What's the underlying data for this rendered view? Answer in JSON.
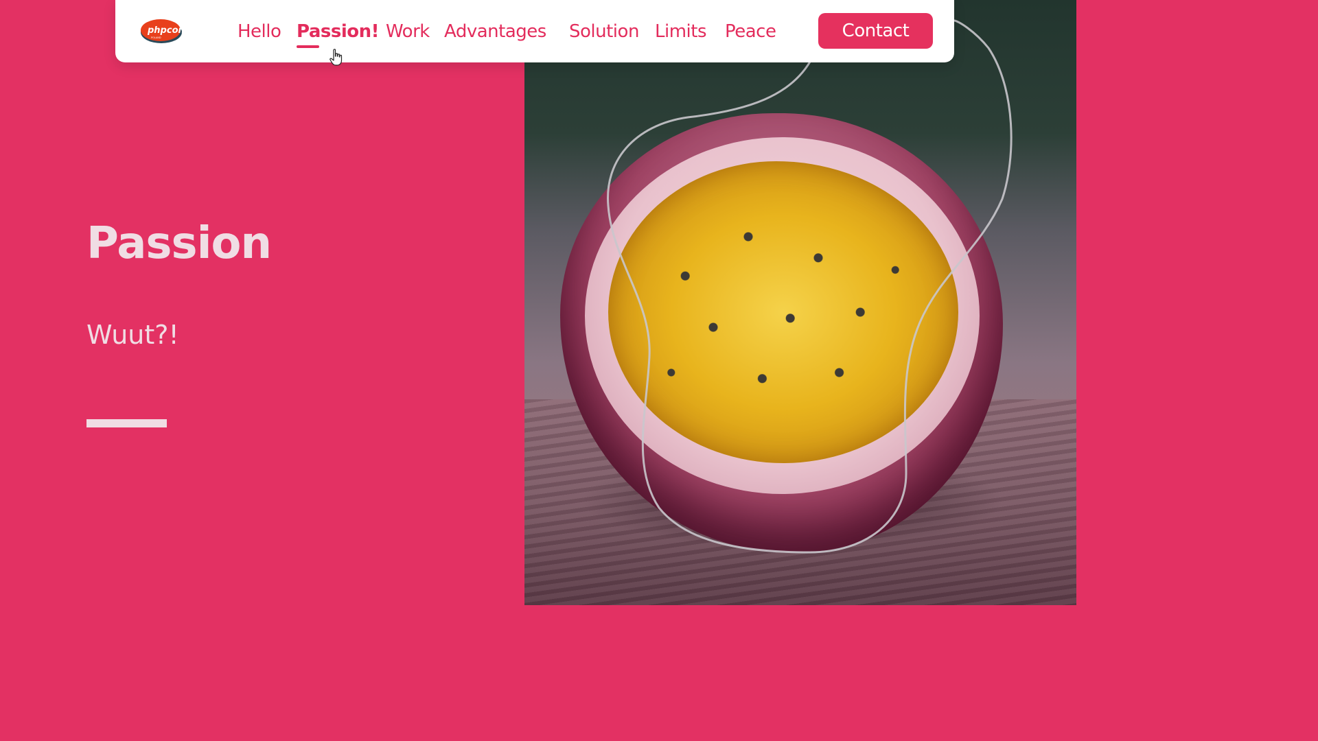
{
  "nav": {
    "logo_text": "phpcon",
    "logo_sub": "POLAND",
    "items": [
      {
        "label": "Hello"
      },
      {
        "label": "Passion!",
        "active": true
      },
      {
        "label": "Work"
      },
      {
        "label": "Advantages"
      },
      {
        "label": "Solution"
      },
      {
        "label": "Limits"
      },
      {
        "label": "Peace"
      }
    ],
    "contact_label": "Contact"
  },
  "hero": {
    "title": "Passion",
    "subtitle": "Wuut?!"
  },
  "colors": {
    "brand": "#e33163",
    "text_light": "#f0dde4",
    "nav_text": "#e32c5c"
  },
  "icons": {
    "cursor": "hand-pointer-icon",
    "logo": "phpcon-logo"
  }
}
